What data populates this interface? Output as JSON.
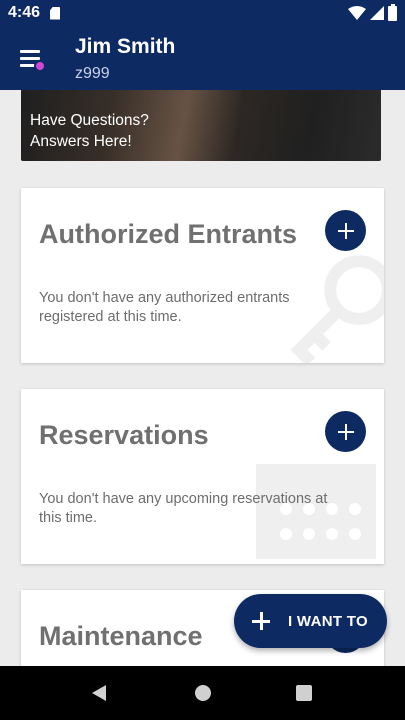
{
  "status_bar": {
    "time": "4:46",
    "icons": [
      "sd-card-icon",
      "wifi-icon",
      "signal-icon",
      "battery-icon"
    ]
  },
  "app_bar": {
    "user_name": "Jim Smith",
    "user_id": "z999",
    "menu_icon": "hamburger-menu-icon",
    "notification_dot_color": "#d147d6"
  },
  "banner": {
    "text": "Have Questions?\nAnswers Here!"
  },
  "cards": {
    "authorized_entrants": {
      "title": "Authorized Entrants",
      "body": "You don't have any authorized entrants registered at this time.",
      "icon": "key-icon"
    },
    "reservations": {
      "title": "Reservations",
      "body": "You don't have any upcoming reservations at this time.",
      "icon": "calendar-icon"
    },
    "maintenance": {
      "title": "Maintenance"
    }
  },
  "fab": {
    "label": "I WANT TO"
  },
  "colors": {
    "primary": "#0d2a63",
    "background": "#ececec",
    "card": "#ffffff",
    "title_text": "#707070"
  }
}
